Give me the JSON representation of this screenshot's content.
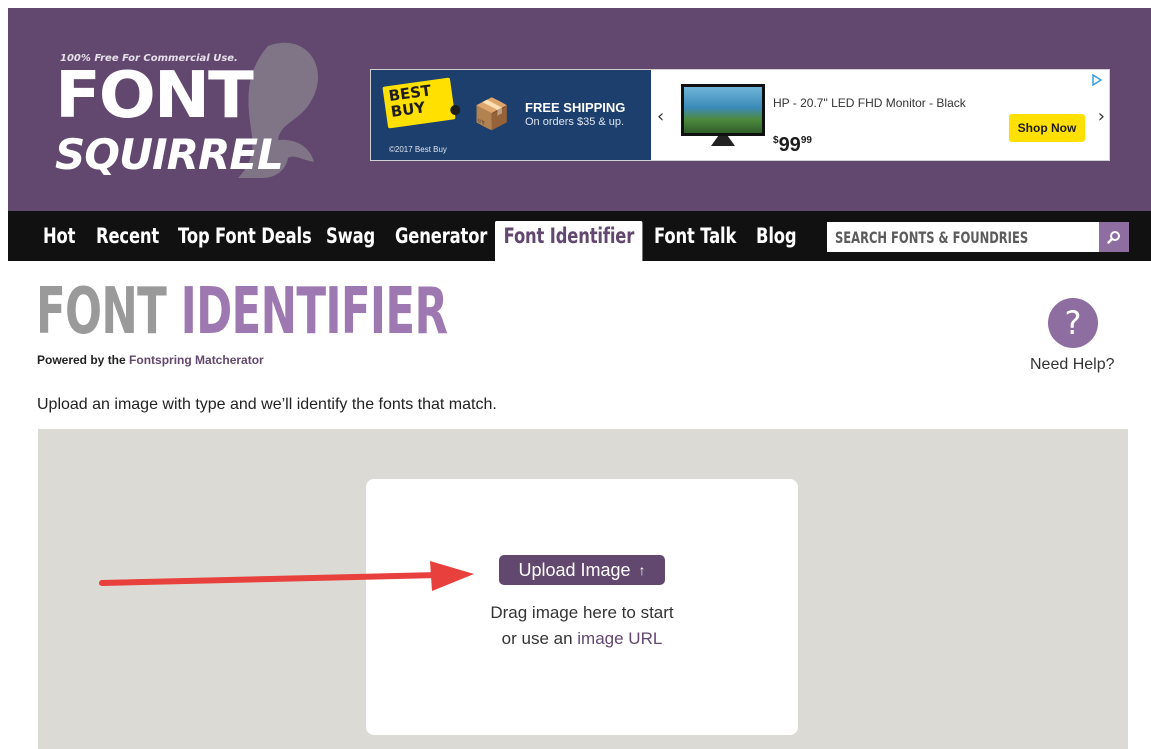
{
  "logo": {
    "tagline": "100% Free For Commercial Use.",
    "word1": "FONT",
    "word2": "SQUIRREL"
  },
  "ad": {
    "brand": "BEST BUY",
    "shipping_title": "FREE SHIPPING",
    "shipping_sub": "On orders $35 & up.",
    "copyright": "©2017 Best Buy",
    "product": "HP - 20.7\" LED FHD Monitor - Black",
    "price_currency": "$",
    "price_main": "99",
    "price_cents": "99",
    "cta": "Shop Now"
  },
  "nav": {
    "items": [
      "Hot",
      "Recent",
      "Top Font Deals",
      "Swag",
      "Generator",
      "Font Identifier",
      "Font Talk",
      "Blog"
    ],
    "active": "Font Identifier",
    "search_placeholder": "SEARCH FONTS & FOUNDRIES"
  },
  "page": {
    "title_part1": "FONT",
    "title_part2": "IDENTIFIER",
    "powered_prefix": "Powered by the",
    "powered_link": "Fontspring Matcherator",
    "help_symbol": "?",
    "help_label": "Need Help?",
    "intro": "Upload an image with type and we’ll identify the fonts that match."
  },
  "uploader": {
    "button_label": "Upload Image",
    "drag_text": "Drag image here to start",
    "url_prefix": "or use an",
    "url_link": "image URL"
  },
  "colors": {
    "brand_purple": "#62476e",
    "light_purple": "#9e78b0",
    "dropzone_bg": "#dcdad4",
    "annotation_arrow": "#e8403d"
  }
}
